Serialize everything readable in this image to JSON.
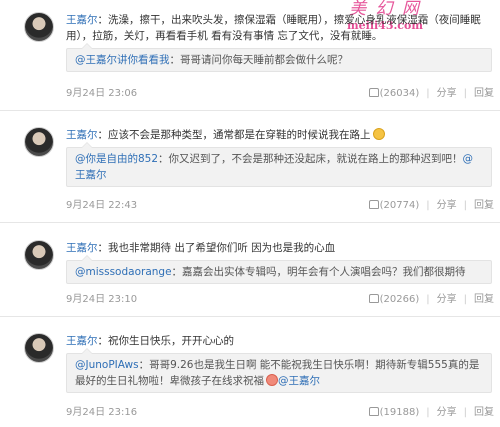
{
  "watermark": {
    "title": "美 幻 网",
    "url": "meili43.com"
  },
  "posts": [
    {
      "author": "王嘉尔",
      "text": "：洗澡，擦干，出来吹头发，擦保湿霜（睡眠用），擦爱心身乳液保湿霜（夜间睡眠用），拉筋，关灯，再看看手机 看有没有事情 忘了文代，没有就睡。",
      "quote_at": "@王嘉尔讲你看看我",
      "quote_text": "：哥哥请问你每天睡前都会做什么呢？",
      "time": "9月24日 23:06",
      "likes": "(26034)",
      "share": "分享",
      "reply": "回复"
    },
    {
      "author": "王嘉尔",
      "text": "：应该不会是那种类型，通常都是在穿鞋的时候说我在路上",
      "quote_at": "@你是自由的852",
      "quote_text": "：你又迟到了，不会是那种还没起床，就说在路上的那种迟到吧！",
      "quote_tail_at": "@王嘉尔",
      "time": "9月24日 22:43",
      "likes": "(20774)",
      "share": "分享",
      "reply": "回复"
    },
    {
      "author": "王嘉尔",
      "text": "：我也非常期待 出了希望你们听 因为也是我的心血",
      "quote_at": "@misssodaorange",
      "quote_text": "：嘉嘉会出实体专辑吗，明年会有个人演唱会吗？我们都很期待",
      "time": "9月24日 23:10",
      "likes": "(20266)",
      "share": "分享",
      "reply": "回复"
    },
    {
      "author": "王嘉尔",
      "text": "：祝你生日快乐，开开心心的",
      "quote_at": "@JunoPIAws",
      "quote_text": "：哥哥9.26也是我生日啊 能不能祝我生日快乐啊！期待新专辑555真的是最好的生日礼物啦！卑微孩子在线求祝福",
      "quote_tail_at": "@王嘉尔",
      "time": "9月24日 23:16",
      "likes": "(19188)",
      "share": "分享",
      "reply": "回复"
    }
  ]
}
